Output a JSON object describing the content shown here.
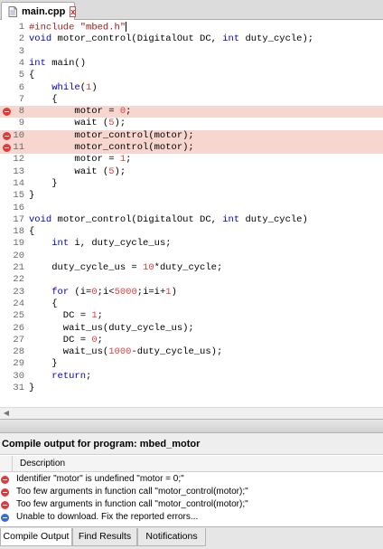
{
  "tab": {
    "title": "main.cpp",
    "close_label": "x",
    "file_icon": "file-icon"
  },
  "editor": {
    "lines": [
      {
        "n": "1",
        "code": "#include \"mbed.h\"",
        "error": false
      },
      {
        "n": "2",
        "code": "void motor_control(DigitalOut DC, int duty_cycle);",
        "error": false
      },
      {
        "n": "3",
        "code": "",
        "error": false
      },
      {
        "n": "4",
        "code": "int main()",
        "error": false
      },
      {
        "n": "5",
        "code": "{",
        "error": false
      },
      {
        "n": "6",
        "code": "    while(1)",
        "error": false
      },
      {
        "n": "7",
        "code": "    {",
        "error": false
      },
      {
        "n": "8",
        "code": "        motor = 0;",
        "error": true
      },
      {
        "n": "9",
        "code": "        wait (5);",
        "error": false
      },
      {
        "n": "10",
        "code": "        motor_control(motor);",
        "error": true
      },
      {
        "n": "11",
        "code": "        motor_control(motor);",
        "error": true
      },
      {
        "n": "12",
        "code": "        motor = 1;",
        "error": false
      },
      {
        "n": "13",
        "code": "        wait (5);",
        "error": false
      },
      {
        "n": "14",
        "code": "    }",
        "error": false
      },
      {
        "n": "15",
        "code": "}",
        "error": false
      },
      {
        "n": "16",
        "code": "",
        "error": false
      },
      {
        "n": "17",
        "code": "void motor_control(DigitalOut DC, int duty_cycle)",
        "error": false
      },
      {
        "n": "18",
        "code": "{",
        "error": false
      },
      {
        "n": "19",
        "code": "    int i, duty_cycle_us;",
        "error": false
      },
      {
        "n": "20",
        "code": "",
        "error": false
      },
      {
        "n": "21",
        "code": "    duty_cycle_us = 10*duty_cycle;",
        "error": false
      },
      {
        "n": "22",
        "code": "",
        "error": false
      },
      {
        "n": "23",
        "code": "    for (i=0;i<5000;i=i+1)",
        "error": false
      },
      {
        "n": "24",
        "code": "    {",
        "error": false
      },
      {
        "n": "25",
        "code": "      DC = 1;",
        "error": false
      },
      {
        "n": "26",
        "code": "      wait_us(duty_cycle_us);",
        "error": false
      },
      {
        "n": "27",
        "code": "      DC = 0;",
        "error": false
      },
      {
        "n": "28",
        "code": "      wait_us(1000-duty_cycle_us);",
        "error": false
      },
      {
        "n": "29",
        "code": "    }",
        "error": false
      },
      {
        "n": "30",
        "code": "    return;",
        "error": false
      },
      {
        "n": "31",
        "code": "}",
        "error": false
      }
    ]
  },
  "output": {
    "title": "Compile output for program: mbed_motor",
    "column_description": "Description",
    "messages": [
      {
        "type": "error",
        "text": "Identifier \"motor\" is undefined \"motor = 0;\""
      },
      {
        "type": "error",
        "text": "Too few arguments in function call \"motor_control(motor);\""
      },
      {
        "type": "error",
        "text": "Too few arguments in function call \"motor_control(motor);\""
      },
      {
        "type": "info",
        "text": "Unable to download. Fix the reported errors..."
      }
    ]
  },
  "bottom_tabs": [
    {
      "label": "Compile Output",
      "active": true
    },
    {
      "label": "Find Results",
      "active": false
    },
    {
      "label": "Notifications",
      "active": false
    }
  ],
  "colors": {
    "error_line_bg": "#f8d6d0",
    "error_icon": "#e03a3a",
    "keyword": "#0000c8",
    "number": "#e04040",
    "string": "#a31515"
  }
}
